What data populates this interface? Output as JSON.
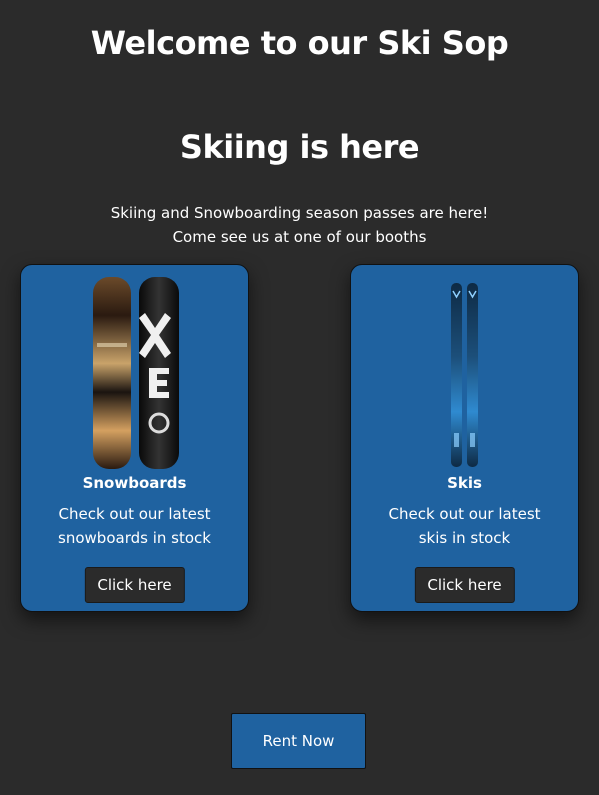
{
  "header": {
    "title": "Welcome to our Ski Sop"
  },
  "hero": {
    "heading": "Skiing is here",
    "line1": "Skiing and Snowboarding season passes are here!",
    "line2": "Come see us at one of our booths"
  },
  "cards": [
    {
      "title": "Snowboards",
      "text_line1": "Check out our latest",
      "text_line2": "snowboards in stock",
      "button_label": "Click here"
    },
    {
      "title": "Skis",
      "text_line1": "Check out our latest",
      "text_line2": "skis in stock",
      "button_label": "Click here"
    }
  ],
  "cta": {
    "rent_label": "Rent Now"
  },
  "colors": {
    "background": "#2b2b2b",
    "card": "#1f62a0",
    "button_dark": "#2b2b2b",
    "text": "#ffffff"
  }
}
